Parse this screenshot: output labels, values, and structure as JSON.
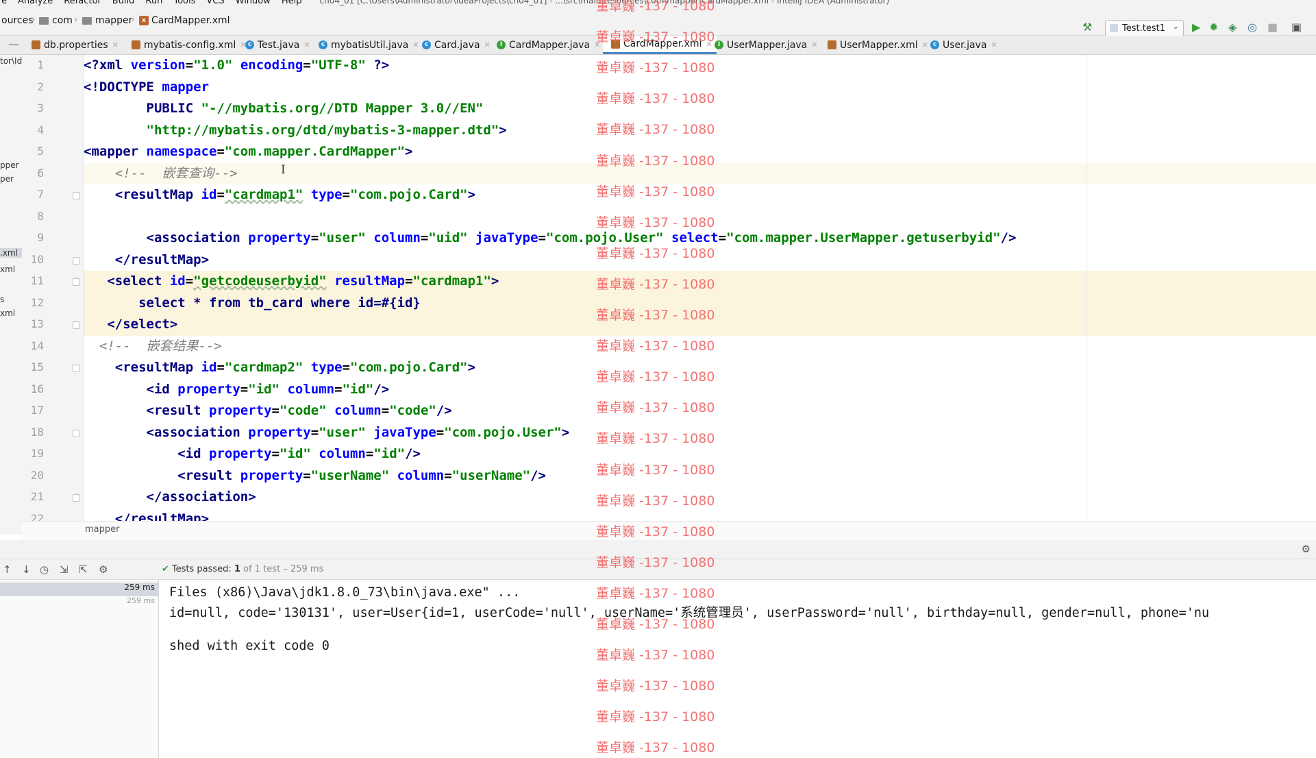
{
  "menubar": {
    "items": [
      "e",
      "Analyze",
      "Refactor",
      "Build",
      "Run",
      "Tools",
      "VCS",
      "Window",
      "Help"
    ],
    "window_title": "ch04_01 [C:\\Users\\Administrator\\IdeaProjects\\ch04_01] - ...\\src\\main\\resources\\com\\mapper\\CardMapper.xml - IntelliJ IDEA (Administrator)"
  },
  "breadcrumb": {
    "items": [
      "ources",
      "com",
      "mapper",
      "CardMapper.xml"
    ]
  },
  "run_config": {
    "label": "Test.test1"
  },
  "tabs": [
    {
      "label": "db.properties",
      "icon": "properties-file-icon"
    },
    {
      "label": "mybatis-config.xml",
      "icon": "xml-file-icon"
    },
    {
      "label": "Test.java",
      "icon": "test-class-icon"
    },
    {
      "label": "mybatisUtil.java",
      "icon": "class-icon"
    },
    {
      "label": "Card.java",
      "icon": "class-icon"
    },
    {
      "label": "CardMapper.java",
      "icon": "interface-icon"
    },
    {
      "label": "CardMapper.xml",
      "icon": "xml-file-icon",
      "active": true
    },
    {
      "label": "UserMapper.java",
      "icon": "interface-icon"
    },
    {
      "label": "UserMapper.xml",
      "icon": "xml-file-icon"
    },
    {
      "label": "User.java",
      "icon": "class-icon"
    }
  ],
  "project_panel": {
    "items": [
      "tor\\Id",
      "pper",
      "per",
      ".xml",
      "xml",
      "s",
      "xml"
    ]
  },
  "editor": {
    "line_numbers": [
      "1",
      "2",
      "3",
      "4",
      "5",
      "6",
      "7",
      "8",
      "9",
      "10",
      "11",
      "12",
      "13",
      "14",
      "15",
      "16",
      "17",
      "18",
      "19",
      "20",
      "21",
      "22"
    ],
    "lines": [
      [
        {
          "t": "<?",
          "c": "tg"
        },
        {
          "t": "xml ",
          "c": "tg"
        },
        {
          "t": "version",
          "c": "an"
        },
        {
          "t": "=",
          "c": "pl"
        },
        {
          "t": "\"1.0\"",
          "c": "av"
        },
        {
          "t": " ",
          "c": "pl"
        },
        {
          "t": "encoding",
          "c": "an"
        },
        {
          "t": "=",
          "c": "pl"
        },
        {
          "t": "\"UTF-8\"",
          "c": "av"
        },
        {
          "t": " ?>",
          "c": "tg"
        }
      ],
      [
        {
          "t": "<!DOCTYPE ",
          "c": "tg"
        },
        {
          "t": "mapper",
          "c": "an"
        }
      ],
      [
        {
          "t": "        PUBLIC ",
          "c": "tg"
        },
        {
          "t": "\"-//mybatis.org//DTD Mapper 3.0//EN\"",
          "c": "av"
        }
      ],
      [
        {
          "t": "        ",
          "c": "pl"
        },
        {
          "t": "\"http://mybatis.org/dtd/mybatis-3-mapper.dtd\"",
          "c": "av"
        },
        {
          "t": ">",
          "c": "tg"
        }
      ],
      [
        {
          "t": "<mapper ",
          "c": "tg"
        },
        {
          "t": "namespace",
          "c": "an"
        },
        {
          "t": "=",
          "c": "pl"
        },
        {
          "t": "\"com.mapper.CardMapper\"",
          "c": "av"
        },
        {
          "t": ">",
          "c": "tg"
        }
      ],
      [
        {
          "t": "    <!--  嵌套查询-->",
          "c": "cm"
        }
      ],
      [
        {
          "t": "    <resultMap ",
          "c": "tg"
        },
        {
          "t": "id",
          "c": "an"
        },
        {
          "t": "=",
          "c": "pl"
        },
        {
          "t": "\"cardmap1\"",
          "c": "av",
          "u": true
        },
        {
          "t": " ",
          "c": "pl"
        },
        {
          "t": "type",
          "c": "an"
        },
        {
          "t": "=",
          "c": "pl"
        },
        {
          "t": "\"com.pojo.Card\"",
          "c": "av"
        },
        {
          "t": ">",
          "c": "tg"
        }
      ],
      [],
      [
        {
          "t": "        <association ",
          "c": "tg"
        },
        {
          "t": "property",
          "c": "an"
        },
        {
          "t": "=",
          "c": "pl"
        },
        {
          "t": "\"user\"",
          "c": "av"
        },
        {
          "t": " ",
          "c": "pl"
        },
        {
          "t": "column",
          "c": "an"
        },
        {
          "t": "=",
          "c": "pl"
        },
        {
          "t": "\"uid\"",
          "c": "av"
        },
        {
          "t": " ",
          "c": "pl"
        },
        {
          "t": "javaType",
          "c": "an"
        },
        {
          "t": "=",
          "c": "pl"
        },
        {
          "t": "\"com.pojo.User\"",
          "c": "av"
        },
        {
          "t": " ",
          "c": "pl"
        },
        {
          "t": "select",
          "c": "an"
        },
        {
          "t": "=",
          "c": "pl"
        },
        {
          "t": "\"com.mapper.UserMapper.getuserbyid\"",
          "c": "av"
        },
        {
          "t": "/>",
          "c": "tg"
        }
      ],
      [
        {
          "t": "    </resultMap>",
          "c": "tg"
        }
      ],
      [
        {
          "t": "   <select ",
          "c": "tg"
        },
        {
          "t": "id",
          "c": "an"
        },
        {
          "t": "=",
          "c": "pl"
        },
        {
          "t": "\"getcodeuserbyid\"",
          "c": "av",
          "u": true
        },
        {
          "t": " ",
          "c": "pl"
        },
        {
          "t": "resultMap",
          "c": "an"
        },
        {
          "t": "=",
          "c": "pl"
        },
        {
          "t": "\"cardmap1\"",
          "c": "av"
        },
        {
          "t": ">",
          "c": "tg"
        }
      ],
      [
        {
          "t": "       select * from tb_card where id=#{id}",
          "c": "tg"
        }
      ],
      [
        {
          "t": "   </select>",
          "c": "tg"
        }
      ],
      [
        {
          "t": "  <!--  嵌套结果-->",
          "c": "cm"
        }
      ],
      [
        {
          "t": "    <resultMap ",
          "c": "tg"
        },
        {
          "t": "id",
          "c": "an"
        },
        {
          "t": "=",
          "c": "pl"
        },
        {
          "t": "\"cardmap2\"",
          "c": "av"
        },
        {
          "t": " ",
          "c": "pl"
        },
        {
          "t": "type",
          "c": "an"
        },
        {
          "t": "=",
          "c": "pl"
        },
        {
          "t": "\"com.pojo.Card\"",
          "c": "av"
        },
        {
          "t": ">",
          "c": "tg"
        }
      ],
      [
        {
          "t": "        <id ",
          "c": "tg"
        },
        {
          "t": "property",
          "c": "an"
        },
        {
          "t": "=",
          "c": "pl"
        },
        {
          "t": "\"id\"",
          "c": "av"
        },
        {
          "t": " ",
          "c": "pl"
        },
        {
          "t": "column",
          "c": "an"
        },
        {
          "t": "=",
          "c": "pl"
        },
        {
          "t": "\"id\"",
          "c": "av"
        },
        {
          "t": "/>",
          "c": "tg"
        }
      ],
      [
        {
          "t": "        <result ",
          "c": "tg"
        },
        {
          "t": "property",
          "c": "an"
        },
        {
          "t": "=",
          "c": "pl"
        },
        {
          "t": "\"code\"",
          "c": "av"
        },
        {
          "t": " ",
          "c": "pl"
        },
        {
          "t": "column",
          "c": "an"
        },
        {
          "t": "=",
          "c": "pl"
        },
        {
          "t": "\"code\"",
          "c": "av"
        },
        {
          "t": "/>",
          "c": "tg"
        }
      ],
      [
        {
          "t": "        <association ",
          "c": "tg"
        },
        {
          "t": "property",
          "c": "an"
        },
        {
          "t": "=",
          "c": "pl"
        },
        {
          "t": "\"user\"",
          "c": "av"
        },
        {
          "t": " ",
          "c": "pl"
        },
        {
          "t": "javaType",
          "c": "an"
        },
        {
          "t": "=",
          "c": "pl"
        },
        {
          "t": "\"com.pojo.User\"",
          "c": "av"
        },
        {
          "t": ">",
          "c": "tg"
        }
      ],
      [
        {
          "t": "            <id ",
          "c": "tg"
        },
        {
          "t": "property",
          "c": "an"
        },
        {
          "t": "=",
          "c": "pl"
        },
        {
          "t": "\"id\"",
          "c": "av"
        },
        {
          "t": " ",
          "c": "pl"
        },
        {
          "t": "column",
          "c": "an"
        },
        {
          "t": "=",
          "c": "pl"
        },
        {
          "t": "\"id\"",
          "c": "av"
        },
        {
          "t": "/>",
          "c": "tg"
        }
      ],
      [
        {
          "t": "            <result ",
          "c": "tg"
        },
        {
          "t": "property",
          "c": "an"
        },
        {
          "t": "=",
          "c": "pl"
        },
        {
          "t": "\"userName\"",
          "c": "av"
        },
        {
          "t": " ",
          "c": "pl"
        },
        {
          "t": "column",
          "c": "an"
        },
        {
          "t": "=",
          "c": "pl"
        },
        {
          "t": "\"userName\"",
          "c": "av"
        },
        {
          "t": "/>",
          "c": "tg"
        }
      ],
      [
        {
          "t": "        </association>",
          "c": "tg"
        }
      ],
      [
        {
          "t": "    </resultMap>",
          "c": "tg"
        }
      ]
    ]
  },
  "editor_breadcrumb": "mapper",
  "run_panel": {
    "tests_passed_label": "Tests passed:",
    "tests_passed_count": "1",
    "tests_total": "of 1 test – 259 ms",
    "tree_times": [
      "259 ms",
      "259 ms"
    ],
    "console_lines": [
      "Files (x86)\\Java\\jdk1.8.0_73\\bin\\java.exe\" ...",
      "id=null, code='130131', user=User{id=1, userCode='null', userName='系统管理员', userPassword='null', birthday=null, gender=null, phone='nu",
      "",
      "shed with exit code 0"
    ]
  },
  "watermark": {
    "text": "董卓巍 -137 - 1080",
    "rows": 25
  },
  "colors": {
    "tag": "#000080",
    "attr_name": "#0000ff",
    "attr_value": "#008000",
    "comment": "#808080",
    "watermark": "#f06a6a",
    "active_tab_underline": "#4a88c7",
    "highlight_line": "#fcf5dd"
  }
}
